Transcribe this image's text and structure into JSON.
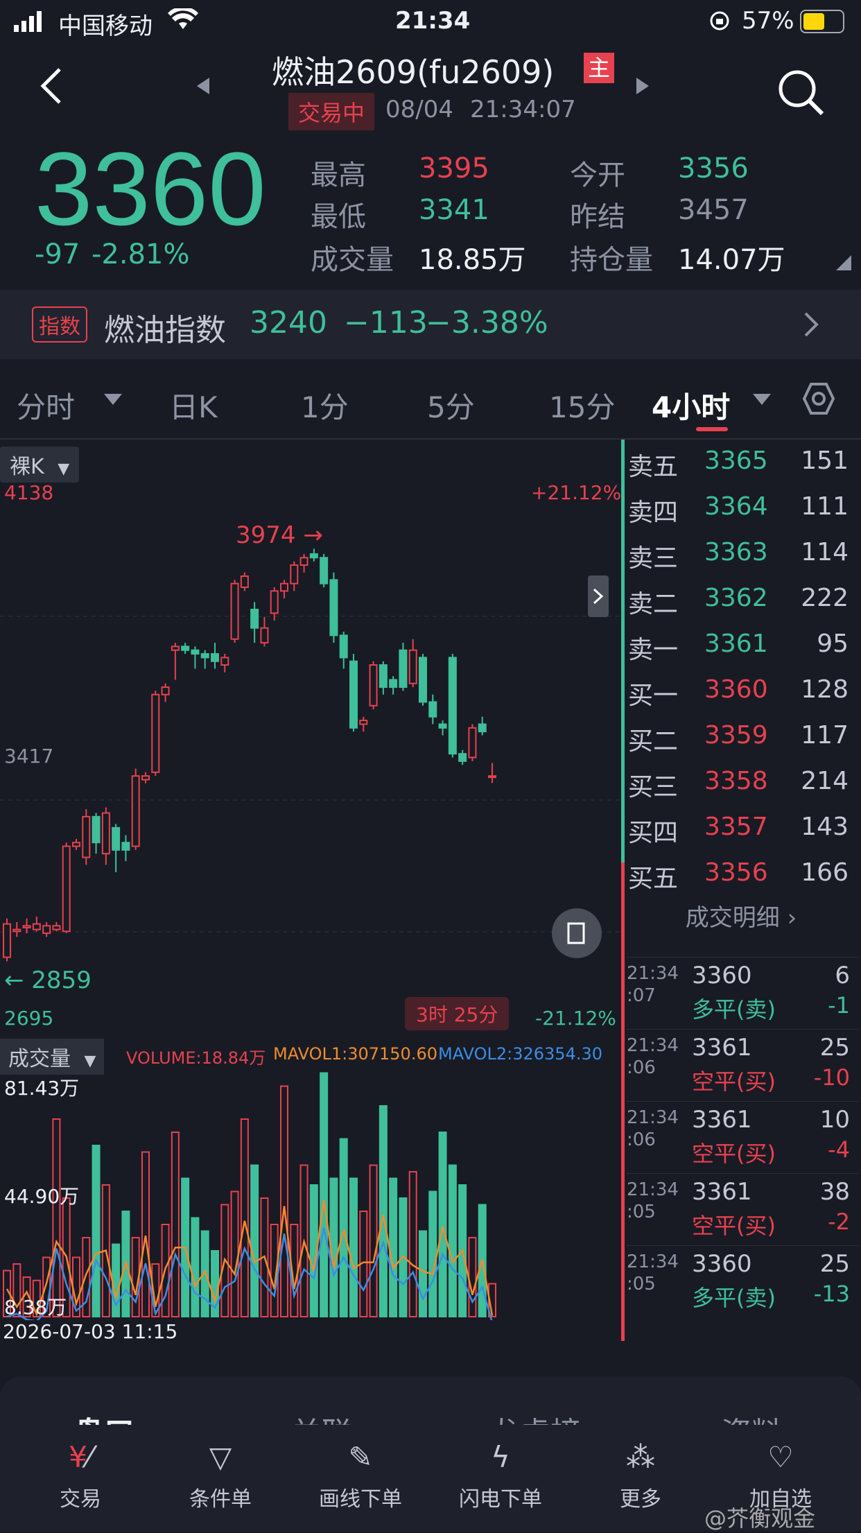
{
  "status_bar": {
    "carrier": "中国移动",
    "time": "21:34",
    "battery": "57%",
    "battery_level": 0.57
  },
  "header": {
    "title": "燃油2609(fu2609)",
    "main_badge": "主",
    "trade_status": "交易中",
    "date": "08/04",
    "time": "21:34:07"
  },
  "quote": {
    "price": "3360",
    "change": "-97",
    "change_pct": "-2.81%",
    "stats": [
      {
        "label": "最高",
        "value": "3395",
        "color": "red"
      },
      {
        "label": "今开",
        "value": "3356",
        "color": "green"
      },
      {
        "label": "最低",
        "value": "3341",
        "color": "green"
      },
      {
        "label": "昨结",
        "value": "3457",
        "color": "muted"
      },
      {
        "label": "成交量",
        "value": "18.85万",
        "color": "white"
      },
      {
        "label": "持仓量",
        "value": "14.07万",
        "color": "white"
      }
    ]
  },
  "index_bar": {
    "badge": "指数",
    "name": "燃油指数",
    "price": "3240",
    "change": "−113",
    "change_pct": "−3.38%"
  },
  "tabs": [
    "分时",
    "日K",
    "1分",
    "5分",
    "15分",
    "4小时"
  ],
  "active_tab": "4小时",
  "chart": {
    "mode_label": "裸K",
    "y_top": "4138",
    "y_mid": "3417",
    "y_bottom": "2695",
    "pct_top": "+21.12%",
    "pct_bottom": "-21.12%",
    "high_label": "3974",
    "low_label": "2859",
    "countdown": "3时 25分"
  },
  "chart_data": {
    "type": "candlestick",
    "ylim": [
      2695,
      4138
    ],
    "candles": [
      {
        "o": 2870,
        "c": 2960,
        "h": 2975,
        "l": 2859,
        "up": true
      },
      {
        "o": 2940,
        "c": 2945,
        "h": 2965,
        "l": 2925,
        "up": true
      },
      {
        "o": 2950,
        "c": 2955,
        "h": 2975,
        "l": 2935,
        "up": true
      },
      {
        "o": 2945,
        "c": 2960,
        "h": 2980,
        "l": 2940,
        "up": true
      },
      {
        "o": 2935,
        "c": 2955,
        "h": 2965,
        "l": 2925,
        "up": true
      },
      {
        "o": 2945,
        "c": 2955,
        "h": 2965,
        "l": 2940,
        "up": true
      },
      {
        "o": 2940,
        "c": 3170,
        "h": 3180,
        "l": 2935,
        "up": true
      },
      {
        "o": 3170,
        "c": 3180,
        "h": 3190,
        "l": 3160,
        "up": true
      },
      {
        "o": 3140,
        "c": 3250,
        "h": 3270,
        "l": 3120,
        "up": true
      },
      {
        "o": 3250,
        "c": 3180,
        "h": 3260,
        "l": 3150,
        "up": false
      },
      {
        "o": 3150,
        "c": 3260,
        "h": 3275,
        "l": 3120,
        "up": true
      },
      {
        "o": 3220,
        "c": 3160,
        "h": 3230,
        "l": 3100,
        "up": false
      },
      {
        "o": 3180,
        "c": 3160,
        "h": 3200,
        "l": 3130,
        "up": false
      },
      {
        "o": 3170,
        "c": 3360,
        "h": 3380,
        "l": 3160,
        "up": true
      },
      {
        "o": 3350,
        "c": 3360,
        "h": 3370,
        "l": 3340,
        "up": true
      },
      {
        "o": 3370,
        "c": 3580,
        "h": 3590,
        "l": 3360,
        "up": true
      },
      {
        "o": 3580,
        "c": 3600,
        "h": 3610,
        "l": 3560,
        "up": true
      },
      {
        "o": 3700,
        "c": 3710,
        "h": 3720,
        "l": 3620,
        "up": true
      },
      {
        "o": 3700,
        "c": 3710,
        "h": 3720,
        "l": 3690,
        "up": false
      },
      {
        "o": 3700,
        "c": 3690,
        "h": 3710,
        "l": 3650,
        "up": false
      },
      {
        "o": 3690,
        "c": 3680,
        "h": 3700,
        "l": 3650,
        "up": false
      },
      {
        "o": 3690,
        "c": 3670,
        "h": 3720,
        "l": 3650,
        "up": false
      },
      {
        "o": 3660,
        "c": 3680,
        "h": 3690,
        "l": 3640,
        "up": true
      },
      {
        "o": 3730,
        "c": 3880,
        "h": 3890,
        "l": 3720,
        "up": true
      },
      {
        "o": 3870,
        "c": 3900,
        "h": 3910,
        "l": 3860,
        "up": true
      },
      {
        "o": 3810,
        "c": 3760,
        "h": 3830,
        "l": 3720,
        "up": false
      },
      {
        "o": 3720,
        "c": 3760,
        "h": 3790,
        "l": 3710,
        "up": true
      },
      {
        "o": 3800,
        "c": 3860,
        "h": 3870,
        "l": 3780,
        "up": true
      },
      {
        "o": 3860,
        "c": 3880,
        "h": 3890,
        "l": 3840,
        "up": true
      },
      {
        "o": 3880,
        "c": 3930,
        "h": 3940,
        "l": 3860,
        "up": true
      },
      {
        "o": 3930,
        "c": 3950,
        "h": 3960,
        "l": 3910,
        "up": true
      },
      {
        "o": 3950,
        "c": 3960,
        "h": 3974,
        "l": 3940,
        "up": false
      },
      {
        "o": 3950,
        "c": 3880,
        "h": 3960,
        "l": 3870,
        "up": false
      },
      {
        "o": 3890,
        "c": 3740,
        "h": 3910,
        "l": 3720,
        "up": false
      },
      {
        "o": 3740,
        "c": 3680,
        "h": 3750,
        "l": 3650,
        "up": false
      },
      {
        "o": 3670,
        "c": 3490,
        "h": 3690,
        "l": 3480,
        "up": false
      },
      {
        "o": 3500,
        "c": 3510,
        "h": 3520,
        "l": 3480,
        "up": true
      },
      {
        "o": 3550,
        "c": 3660,
        "h": 3670,
        "l": 3540,
        "up": true
      },
      {
        "o": 3660,
        "c": 3600,
        "h": 3670,
        "l": 3580,
        "up": false
      },
      {
        "o": 3600,
        "c": 3620,
        "h": 3630,
        "l": 3580,
        "up": false
      },
      {
        "o": 3600,
        "c": 3700,
        "h": 3720,
        "l": 3590,
        "up": false
      },
      {
        "o": 3700,
        "c": 3610,
        "h": 3730,
        "l": 3600,
        "up": true
      },
      {
        "o": 3680,
        "c": 3560,
        "h": 3690,
        "l": 3550,
        "up": false
      },
      {
        "o": 3560,
        "c": 3520,
        "h": 3580,
        "l": 3500,
        "up": false
      },
      {
        "o": 3500,
        "c": 3490,
        "h": 3510,
        "l": 3470,
        "up": false
      },
      {
        "o": 3680,
        "c": 3420,
        "h": 3690,
        "l": 3410,
        "up": false
      },
      {
        "o": 3420,
        "c": 3400,
        "h": 3430,
        "l": 3390,
        "up": false
      },
      {
        "o": 3410,
        "c": 3490,
        "h": 3500,
        "l": 3400,
        "up": true
      },
      {
        "o": 3480,
        "c": 3500,
        "h": 3520,
        "l": 3470,
        "up": false
      },
      {
        "o": 3360,
        "c": 3360,
        "h": 3395,
        "l": 3341,
        "up": true
      }
    ]
  },
  "volume": {
    "label": "成交量",
    "volume_text": "VOLUME:18.84万",
    "mavol1_text": "MAVOL1:307150.60",
    "mavol2_text": "MAVOL2:326354.30",
    "y_top": "81.43万",
    "y_mid": "44.90万",
    "y_bottom": "8.38万",
    "date_label": "2026-07-03 11:15"
  },
  "orderbook": {
    "asks": [
      {
        "label": "卖五",
        "price": "3365",
        "qty": "151"
      },
      {
        "label": "卖四",
        "price": "3364",
        "qty": "111"
      },
      {
        "label": "卖三",
        "price": "3363",
        "qty": "114"
      },
      {
        "label": "卖二",
        "price": "3362",
        "qty": "222"
      },
      {
        "label": "卖一",
        "price": "3361",
        "qty": "95"
      }
    ],
    "bids": [
      {
        "label": "买一",
        "price": "3360",
        "qty": "128"
      },
      {
        "label": "买二",
        "price": "3359",
        "qty": "117"
      },
      {
        "label": "买三",
        "price": "3358",
        "qty": "214"
      },
      {
        "label": "买四",
        "price": "3357",
        "qty": "143"
      },
      {
        "label": "买五",
        "price": "3356",
        "qty": "166"
      }
    ],
    "detail_link": "成交明细",
    "trades": [
      {
        "time1": "21:34",
        "time2": ":07",
        "price": "3360",
        "qty": "6",
        "type": "多平(卖)",
        "delta": "-1",
        "type_color": "green"
      },
      {
        "time1": "21:34",
        "time2": ":06",
        "price": "3361",
        "qty": "25",
        "type": "空平(买)",
        "delta": "-10",
        "type_color": "red"
      },
      {
        "time1": "21:34",
        "time2": ":06",
        "price": "3361",
        "qty": "10",
        "type": "空平(买)",
        "delta": "-4",
        "type_color": "red"
      },
      {
        "time1": "21:34",
        "time2": ":05",
        "price": "3361",
        "qty": "38",
        "type": "空平(买)",
        "delta": "-2",
        "type_color": "red"
      },
      {
        "time1": "21:34",
        "time2": ":05",
        "price": "3360",
        "qty": "25",
        "type": "多平(卖)",
        "delta": "-13",
        "type_color": "green"
      }
    ]
  },
  "bottom_section_tabs": [
    "盘口",
    "关联",
    "龙虎榜",
    "资料"
  ],
  "bottom_nav": [
    {
      "label": "交易",
      "icon": "trade-icon"
    },
    {
      "label": "条件单",
      "icon": "filter-icon"
    },
    {
      "label": "画线下单",
      "icon": "draw-icon"
    },
    {
      "label": "闪电下单",
      "icon": "lightning-icon"
    },
    {
      "label": "更多",
      "icon": "more-icon"
    },
    {
      "label": "加自选",
      "icon": "heart-icon"
    }
  ],
  "watermark": "@芥衡观金"
}
